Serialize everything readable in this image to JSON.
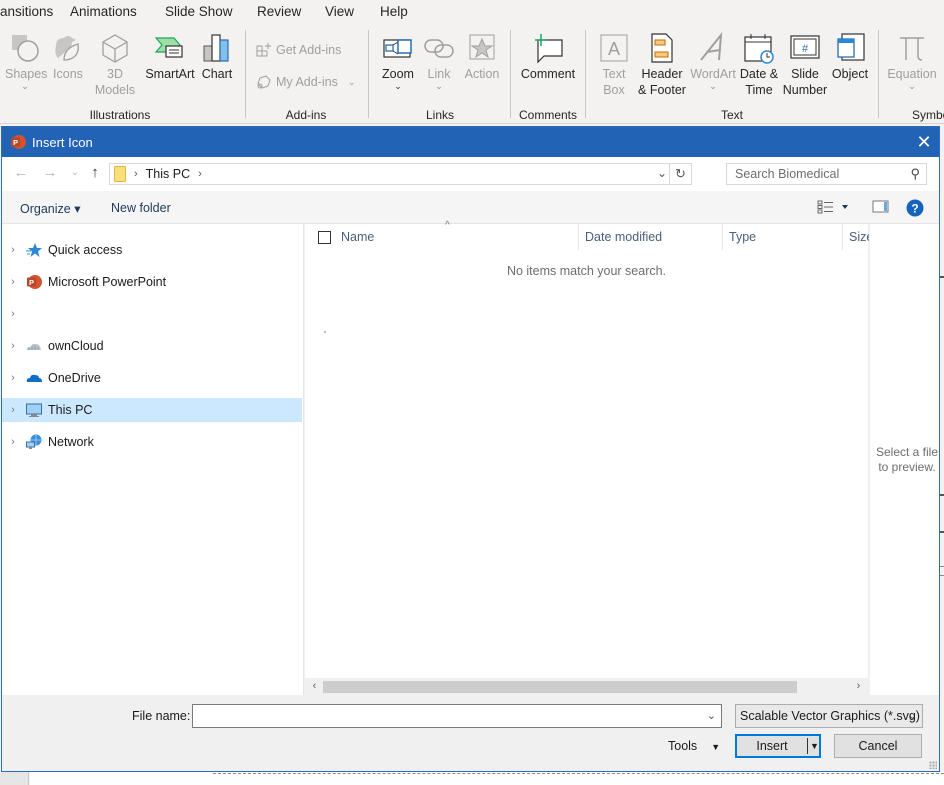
{
  "ribbon": {
    "tabs": [
      "ansitions",
      "Animations",
      "Slide Show",
      "Review",
      "View",
      "Help"
    ],
    "groups": {
      "illustrations": {
        "label": "Illustrations",
        "buttons": [
          {
            "label": "Shapes",
            "icon": "shapes-icon",
            "enabled": false
          },
          {
            "label": "Icons",
            "icon": "icons-icon",
            "enabled": false
          },
          {
            "label_line1": "3D",
            "label_line2": "Models",
            "icon": "3d-models-icon",
            "enabled": false
          },
          {
            "label": "SmartArt",
            "icon": "smartart-icon",
            "enabled": true
          },
          {
            "label": "Chart",
            "icon": "chart-icon",
            "enabled": true
          }
        ]
      },
      "addins": {
        "label": "Add-ins",
        "buttons": [
          {
            "label": "Get Add-ins",
            "icon": "get-addins-icon",
            "enabled": false
          },
          {
            "label": "My Add-ins",
            "icon": "my-addins-icon",
            "enabled": false
          }
        ]
      },
      "links": {
        "label": "Links",
        "buttons": [
          {
            "label": "Zoom",
            "icon": "zoom-icon",
            "enabled": true
          },
          {
            "label": "Link",
            "icon": "link-icon",
            "enabled": false
          },
          {
            "label": "Action",
            "icon": "action-icon",
            "enabled": false
          }
        ]
      },
      "comments": {
        "label": "Comments",
        "buttons": [
          {
            "label": "Comment",
            "icon": "comment-icon",
            "enabled": true
          }
        ]
      },
      "text": {
        "label": "Text",
        "buttons": [
          {
            "label_line1": "Text",
            "label_line2": "Box",
            "icon": "text-box-icon",
            "enabled": false
          },
          {
            "label_line1": "Header",
            "label_line2": "& Footer",
            "icon": "header-footer-icon",
            "enabled": true
          },
          {
            "label": "WordArt",
            "icon": "wordart-icon",
            "enabled": false
          },
          {
            "label_line1": "Date &",
            "label_line2": "Time",
            "icon": "date-time-icon",
            "enabled": true
          },
          {
            "label_line1": "Slide",
            "label_line2": "Number",
            "icon": "slide-number-icon",
            "enabled": true
          },
          {
            "label": "Object",
            "icon": "object-icon",
            "enabled": true
          }
        ]
      },
      "symbols": {
        "label": "Symbo",
        "buttons": [
          {
            "label": "Equation",
            "icon": "equation-icon",
            "enabled": false
          }
        ]
      }
    }
  },
  "dialog": {
    "title": "Insert Icon",
    "close_label": "✕",
    "nav": {
      "back": "←",
      "forward": "→",
      "recent": "⌄",
      "up": "↑",
      "breadcrumb": [
        "This PC"
      ],
      "refresh": "↻"
    },
    "search": {
      "placeholder": "Search Biomedical",
      "value": ""
    },
    "commands": {
      "organize": "Organize ▾",
      "new_folder": "New folder"
    },
    "nav_pane": [
      {
        "label": "Quick access",
        "icon": "quick-access-star-icon",
        "selected": false
      },
      {
        "label": "Microsoft PowerPoint",
        "icon": "powerpoint-icon",
        "selected": false
      },
      {
        "label": "",
        "icon": "",
        "selected": false
      },
      {
        "label": "ownCloud",
        "icon": "owncloud-icon",
        "selected": false
      },
      {
        "label": "OneDrive",
        "icon": "onedrive-icon",
        "selected": false
      },
      {
        "label": "This PC",
        "icon": "this-pc-icon",
        "selected": true
      },
      {
        "label": "Network",
        "icon": "network-icon",
        "selected": false
      }
    ],
    "columns": [
      "Name",
      "Date modified",
      "Type",
      "Size"
    ],
    "empty_message": "No items match your search.",
    "preview_message": "Select a file to preview.",
    "footer": {
      "file_name_label": "File name:",
      "file_name_value": "",
      "file_type": "Scalable Vector Graphics (*.svg)",
      "tools_label": "Tools",
      "insert_label": "Insert",
      "cancel_label": "Cancel"
    }
  }
}
